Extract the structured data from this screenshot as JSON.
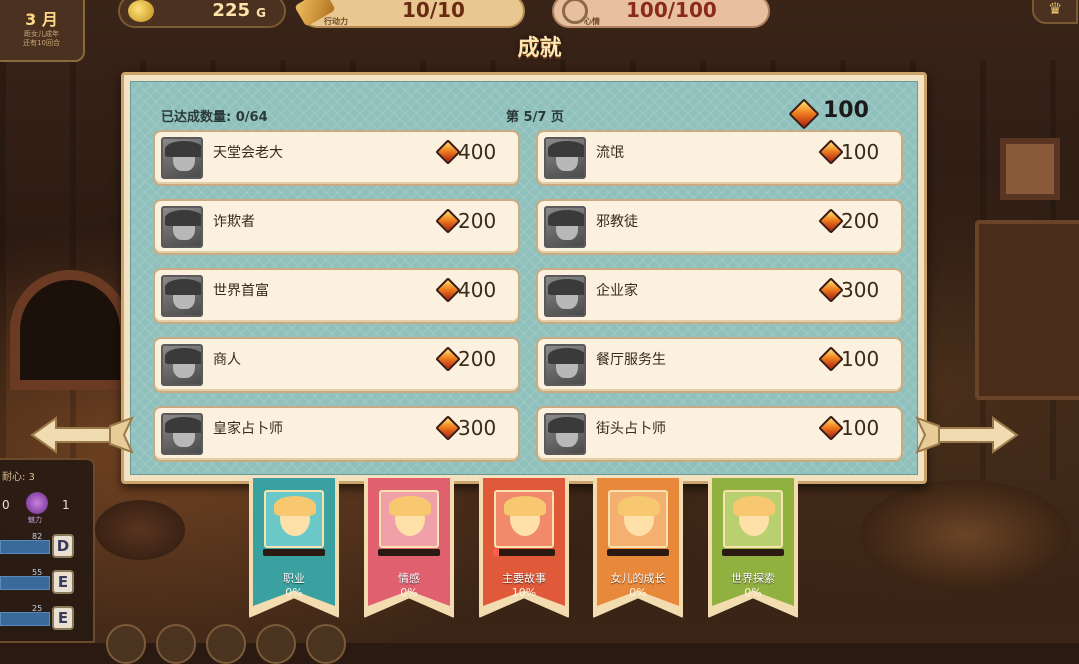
{
  "hud": {
    "month_number": "3",
    "month_unit": "月",
    "month_sub_1": "距女儿成年",
    "month_sub_2": "还有10回合",
    "gold_value": "225",
    "gold_unit": "G",
    "action_label": "行动力",
    "action_value": "10/10",
    "mood_label": "心情",
    "mood_value": "100/100"
  },
  "side_stats": {
    "title": "耐心: 3",
    "zero": "0",
    "charm_label": "魅力",
    "charm_value": "1",
    "rows": [
      {
        "num": "82",
        "grade": "D"
      },
      {
        "num": "55",
        "grade": "E"
      },
      {
        "num": "25",
        "grade": "E"
      }
    ]
  },
  "page": {
    "title": "成就",
    "count_label": "已达成数量: 0/64",
    "page_label": "第 5/7 页",
    "total_gems": "100"
  },
  "achievements_left": [
    {
      "name": "天堂会老大",
      "reward": "400"
    },
    {
      "name": "诈欺者",
      "reward": "200"
    },
    {
      "name": "世界首富",
      "reward": "400"
    },
    {
      "name": "商人",
      "reward": "200"
    },
    {
      "name": "皇家占卜师",
      "reward": "300"
    }
  ],
  "achievements_right": [
    {
      "name": "流氓",
      "reward": "100"
    },
    {
      "name": "邪教徒",
      "reward": "200"
    },
    {
      "name": "企业家",
      "reward": "300"
    },
    {
      "name": "餐厅服务生",
      "reward": "100"
    },
    {
      "name": "街头占卜师",
      "reward": "100"
    }
  ],
  "categories": [
    {
      "label": "职业",
      "percent": "0%",
      "progress": 0,
      "color": "#3aa0a0",
      "pic_color": "#6ac8c8"
    },
    {
      "label": "情感",
      "percent": "0%",
      "progress": 0,
      "color": "#e06070",
      "pic_color": "#f0a0a8"
    },
    {
      "label": "主要故事",
      "percent": "10%",
      "progress": 0.1,
      "color": "#e05a3a",
      "pic_color": "#f08a6a"
    },
    {
      "label": "女儿的成长",
      "percent": "0%",
      "progress": 0,
      "color": "#e8883a",
      "pic_color": "#f4b070"
    },
    {
      "label": "世界探索",
      "percent": "0%",
      "progress": 0,
      "color": "#90b040",
      "pic_color": "#b8d070"
    }
  ],
  "colors": {
    "panel_teal": "#8fc0bc",
    "card_bg": "#fbf1de",
    "gem_orange": "#f08020"
  }
}
